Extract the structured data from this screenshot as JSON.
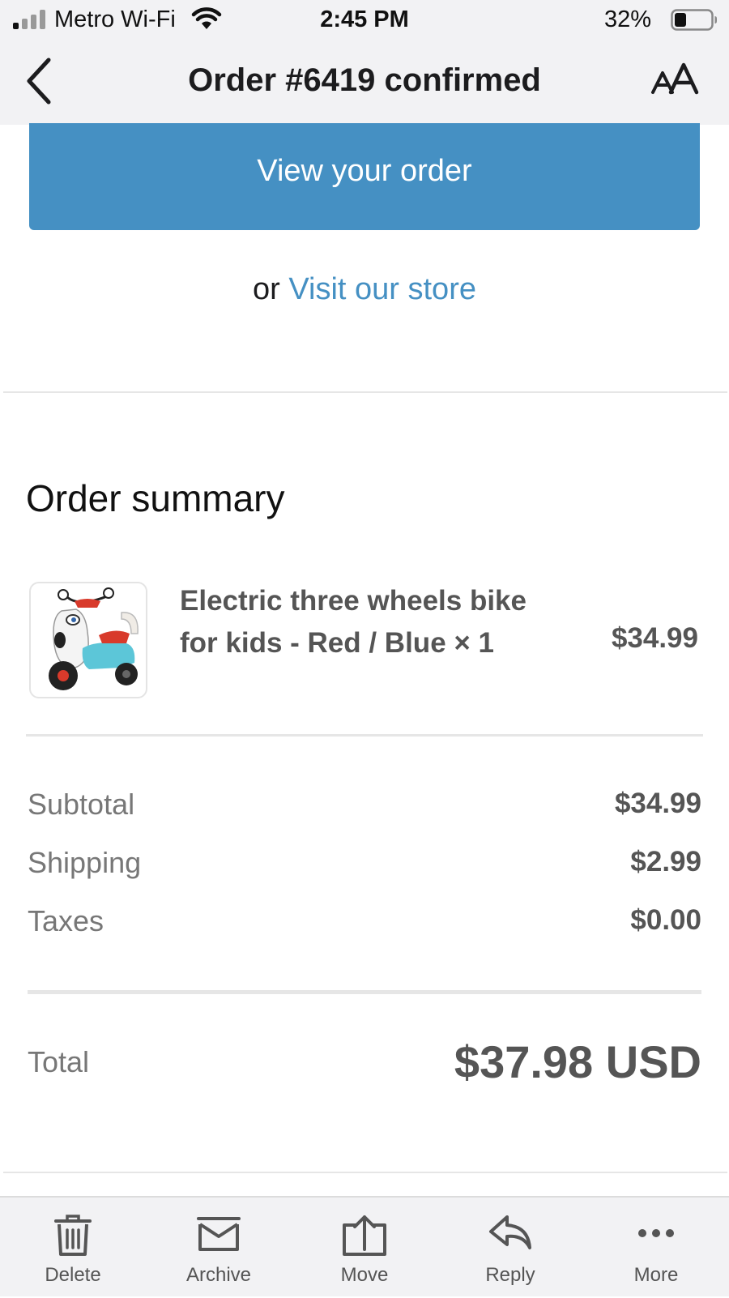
{
  "status_bar": {
    "carrier": "Metro Wi-Fi",
    "time": "2:45 PM",
    "battery_percent": "32%",
    "icons": [
      "signal-icon",
      "wifi-icon",
      "battery-icon"
    ]
  },
  "nav": {
    "title": "Order #6419 confirmed",
    "back_icon": "chevron-left-icon",
    "text_size_icon": "text-size-icon"
  },
  "email": {
    "view_order_label": "View your order",
    "store_prefix": "or ",
    "store_link_label": "Visit our store",
    "section_title": "Order summary",
    "product": {
      "name_line1": "Electric three wheels bike",
      "name_line2": "for kids - Red / Blue × 1",
      "price": "$34.99",
      "image_icon": "tricycle-product-image"
    },
    "costs": [
      {
        "label": "Subtotal",
        "value": "$34.99"
      },
      {
        "label": "Shipping",
        "value": "$2.99"
      },
      {
        "label": "Taxes",
        "value": "$0.00"
      }
    ],
    "total": {
      "label": "Total",
      "value": "$37.98 USD"
    }
  },
  "toolbar": {
    "items": [
      {
        "label": "Delete",
        "icon": "trash-icon"
      },
      {
        "label": "Archive",
        "icon": "archive-icon"
      },
      {
        "label": "Move",
        "icon": "move-icon"
      },
      {
        "label": "Reply",
        "icon": "reply-icon"
      },
      {
        "label": "More",
        "icon": "more-icon"
      }
    ]
  },
  "colors": {
    "accent": "#4590c3",
    "chrome_background": "#f2f2f4",
    "muted_text": "#777777",
    "value_text": "#555555"
  }
}
